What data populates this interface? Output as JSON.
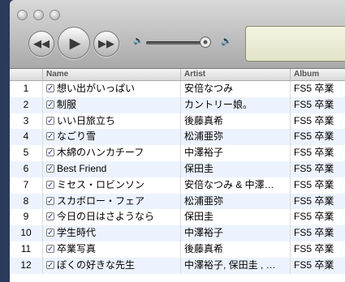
{
  "player": {
    "prev_icon": "rewind-icon",
    "play_icon": "play-icon",
    "next_icon": "fast-forward-icon",
    "volume_level": 0.82
  },
  "columns": {
    "name": "Name",
    "artist": "Artist",
    "album": "Album"
  },
  "tracks": [
    {
      "num": "1",
      "name": "想い出がいっぱい",
      "artist": "安倍なつみ",
      "album": "FS5 卒業"
    },
    {
      "num": "2",
      "name": "制服",
      "artist": "カントリー娘。",
      "album": "FS5 卒業"
    },
    {
      "num": "3",
      "name": "いい日旅立ち",
      "artist": "後藤真希",
      "album": "FS5 卒業"
    },
    {
      "num": "4",
      "name": "なごり雪",
      "artist": "松浦亜弥",
      "album": "FS5 卒業"
    },
    {
      "num": "5",
      "name": "木綿のハンカチーフ",
      "artist": "中澤裕子",
      "album": "FS5 卒業"
    },
    {
      "num": "6",
      "name": "Best Friend",
      "artist": "保田圭",
      "album": "FS5 卒業"
    },
    {
      "num": "7",
      "name": "ミセス・ロビンソン",
      "artist": "安倍なつみ & 中澤…",
      "album": "FS5 卒業"
    },
    {
      "num": "8",
      "name": "スカボロー・フェア",
      "artist": "松浦亜弥",
      "album": "FS5 卒業"
    },
    {
      "num": "9",
      "name": "今日の日はさようなら",
      "artist": "保田圭",
      "album": "FS5 卒業"
    },
    {
      "num": "10",
      "name": "学生時代",
      "artist": "中澤裕子",
      "album": "FS5 卒業"
    },
    {
      "num": "11",
      "name": "卒業写真",
      "artist": "後藤真希",
      "album": "FS5 卒業"
    },
    {
      "num": "12",
      "name": "ぼくの好きな先生",
      "artist": "中澤裕子, 保田圭 , …",
      "album": "FS5 卒業"
    }
  ]
}
